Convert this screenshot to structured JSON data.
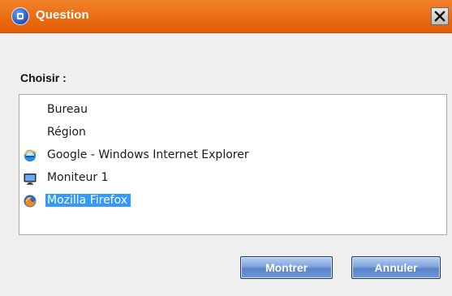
{
  "window": {
    "title": "Question",
    "close_icon": "close-icon",
    "app_icon": "app-icon"
  },
  "prompt": {
    "label": "Choisir :"
  },
  "list": {
    "items": [
      {
        "label": "Bureau",
        "icon": "none",
        "selected": false
      },
      {
        "label": "Région",
        "icon": "none",
        "selected": false
      },
      {
        "label": "Google - Windows Internet Explorer",
        "icon": "internet-explorer-icon",
        "selected": false
      },
      {
        "label": "Moniteur 1",
        "icon": "monitor-icon",
        "selected": false
      },
      {
        "label": "Mozilla Firefox",
        "icon": "firefox-icon",
        "selected": true
      }
    ]
  },
  "buttons": {
    "show_label": "Montrer",
    "cancel_label": "Annuler"
  },
  "colors": {
    "titlebar": "#e8680f",
    "selection": "#3399ff",
    "button": "#6f95d5"
  }
}
